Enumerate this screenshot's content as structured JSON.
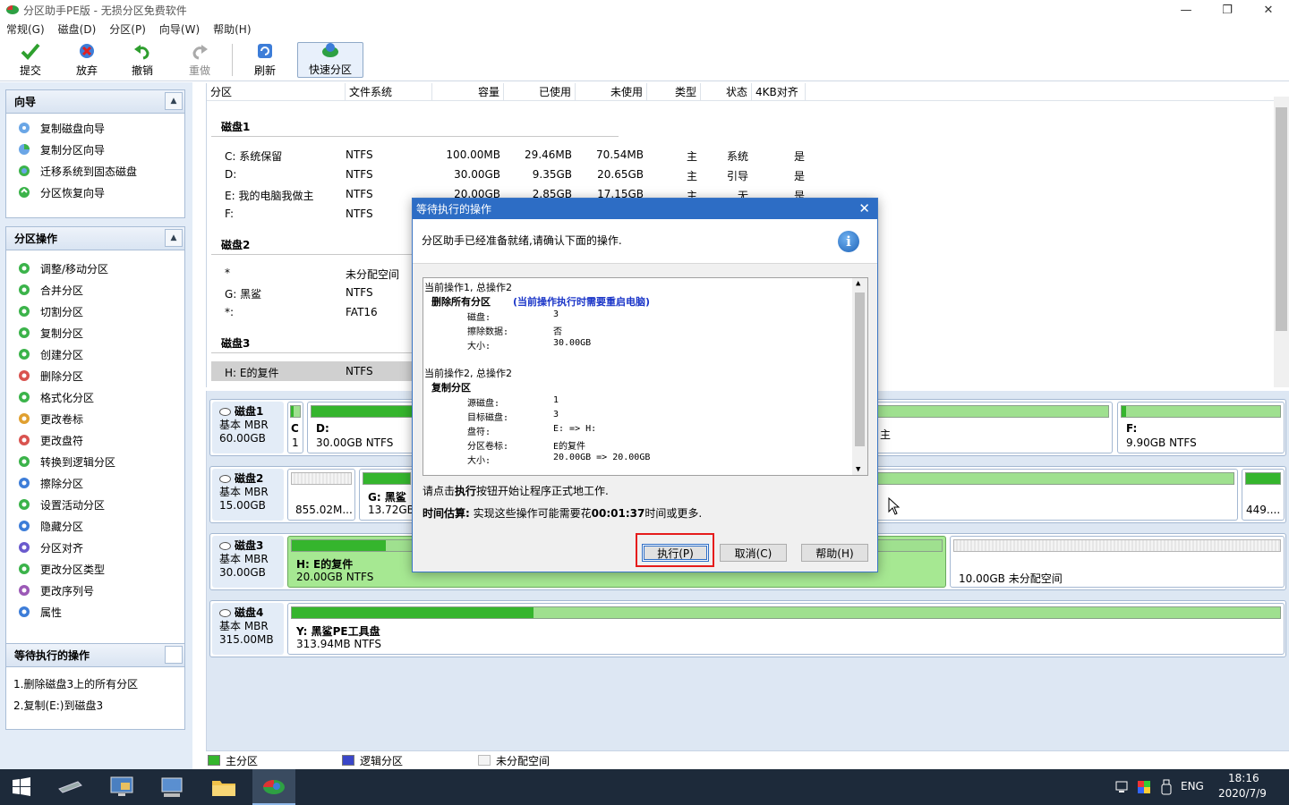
{
  "window": {
    "title": "分区助手PE版 - 无损分区免费软件"
  },
  "menu": [
    "常规(G)",
    "磁盘(D)",
    "分区(P)",
    "向导(W)",
    "帮助(H)"
  ],
  "toolbar": {
    "commit": "提交",
    "discard": "放弃",
    "undo": "撤销",
    "redo": "重做",
    "refresh": "刷新",
    "quick_partition": "快速分区"
  },
  "wizard_panel": {
    "title": "向导",
    "items": [
      "复制磁盘向导",
      "复制分区向导",
      "迁移系统到固态磁盘",
      "分区恢复向导"
    ]
  },
  "ops_panel": {
    "title": "分区操作",
    "items": [
      "调整/移动分区",
      "合并分区",
      "切割分区",
      "复制分区",
      "创建分区",
      "删除分区",
      "格式化分区",
      "更改卷标",
      "更改盘符",
      "转换到逻辑分区",
      "擦除分区",
      "设置活动分区",
      "隐藏分区",
      "分区对齐",
      "更改分区类型",
      "更改序列号",
      "属性"
    ]
  },
  "pending_panel": {
    "title": "等待执行的操作",
    "items": [
      "1.删除磁盘3上的所有分区",
      "2.复制(E:)到磁盘3"
    ]
  },
  "list": {
    "headers": [
      "分区",
      "文件系统",
      "容量",
      "已使用",
      "未使用",
      "类型",
      "状态",
      "4KB对齐"
    ],
    "disk1": "磁盘1",
    "disk1_rows": [
      [
        "C: 系统保留",
        "NTFS",
        "100.00MB",
        "29.46MB",
        "70.54MB",
        "主",
        "系统",
        "是"
      ],
      [
        "D:",
        "NTFS",
        "30.00GB",
        "9.35GB",
        "20.65GB",
        "主",
        "引导",
        "是"
      ],
      [
        "E: 我的电脑我做主",
        "NTFS",
        "20.00GB",
        "2.85GB",
        "17.15GB",
        "主",
        "无",
        "是"
      ],
      [
        "F:",
        "NTFS",
        "",
        "",
        "",
        "",
        "",
        ""
      ]
    ],
    "disk2": "磁盘2",
    "disk2_rows": [
      [
        "*",
        "未分配空间"
      ],
      [
        "G: 黑鲨",
        "NTFS"
      ],
      [
        "*:",
        "FAT16"
      ]
    ],
    "disk3": "磁盘3",
    "disk3_rows": [
      [
        "H: E的复件",
        "NTFS"
      ]
    ]
  },
  "map": {
    "disks": [
      {
        "name": "磁盘1",
        "type": "基本 MBR",
        "size": "60.00GB"
      },
      {
        "name": "磁盘2",
        "type": "基本 MBR",
        "size": "15.00GB"
      },
      {
        "name": "磁盘3",
        "type": "基本 MBR",
        "size": "30.00GB"
      },
      {
        "name": "磁盘4",
        "type": "基本 MBR",
        "size": "315.00MB"
      }
    ],
    "d1_c_label": "C",
    "d1_c_size": "1",
    "d1_d_label": "D:",
    "d1_d_size": "30.00GB NTFS",
    "d1_e_tail": "主",
    "d1_f_label": "F:",
    "d1_f_size": "9.90GB NTFS",
    "d2_u_size": "855.02M...",
    "d2_g_label": "G: 黑鲨",
    "d2_g_size": "13.72GB",
    "d2_last_size": "449....",
    "d3_h_label": "H: E的复件",
    "d3_h_size": "20.00GB NTFS",
    "d3_u_size": "10.00GB 未分配空间",
    "d4_y_label": "Y: 黑鲨PE工具盘",
    "d4_y_size": "313.94MB NTFS"
  },
  "legend": {
    "primary": "主分区",
    "logical": "逻辑分区",
    "unallocated": "未分配空间"
  },
  "dialog": {
    "title": "等待执行的操作",
    "message": "分区助手已经准备就绪,请确认下面的操作.",
    "op1_header": "当前操作1, 总操作2",
    "op1_name": "删除所有分区",
    "op1_note": "(当前操作执行时需要重启电脑)",
    "op1_fields": [
      [
        "磁盘:",
        "3"
      ],
      [
        "擦除数据:",
        "否"
      ],
      [
        "大小:",
        "30.00GB"
      ]
    ],
    "op2_header": "当前操作2, 总操作2",
    "op2_name": "复制分区",
    "op2_fields": [
      [
        "源磁盘:",
        "1"
      ],
      [
        "目标磁盘:",
        "3"
      ],
      [
        "盘符:",
        "E: => H:"
      ],
      [
        "分区卷标:",
        "E的复件"
      ],
      [
        "大小:",
        "20.00GB => 20.00GB"
      ]
    ],
    "hint_pre": "请点击",
    "hint_bold": "执行",
    "hint_post": "按钮开始让程序正式地工作.",
    "time_label": "时间估算:",
    "time_pre": " 实现这些操作可能需要花",
    "time_value": "00:01:37",
    "time_post": "时间或更多.",
    "btn_execute": "执行(P)",
    "btn_cancel": "取消(C)",
    "btn_help": "帮助(H)"
  },
  "taskbar": {
    "lang": "ENG",
    "time": "18:16",
    "date": "2020/7/9"
  }
}
